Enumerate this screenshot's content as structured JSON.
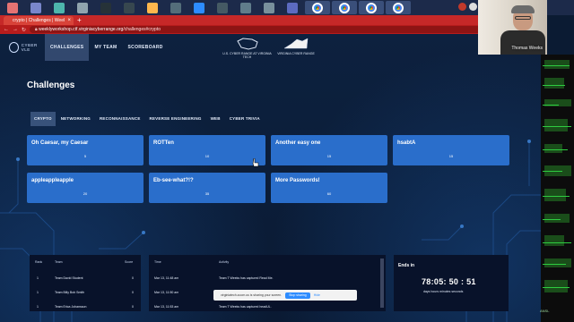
{
  "browser": {
    "tab_title": "crypto | Challenges | Weel",
    "tab_close": "×",
    "new_tab": "+",
    "url_host": "weeklyworkshop.ctf.virginiacyberrange.org",
    "url_path": "/challenges#crypto",
    "window_controls": [
      "–",
      "□",
      "×"
    ]
  },
  "site": {
    "nav": {
      "logo_text": "CYBER VLE",
      "items": [
        {
          "label": "CHALLENGES",
          "active": true
        },
        {
          "label": "MY TEAM",
          "active": false
        },
        {
          "label": "SCOREBOARD",
          "active": false
        }
      ],
      "sponsor_left": "U.S. CYBER RANGE AT VIRGINIA TECH",
      "sponsor_right": "VIRGINIA CYBER RANGE"
    },
    "title": "Challenges",
    "categories": [
      {
        "label": "CRYPTO",
        "active": true
      },
      {
        "label": "NETWORKING",
        "active": false
      },
      {
        "label": "RECONNAISSANCE",
        "active": false
      },
      {
        "label": "REVERSE ENGINEERING",
        "active": false
      },
      {
        "label": "WEB",
        "active": false
      },
      {
        "label": "CYBER TRIVIA",
        "active": false
      }
    ],
    "challenges": [
      {
        "name": "Oh Caesar, my Caesar",
        "points": "5"
      },
      {
        "name": "ROTTen",
        "points": "10"
      },
      {
        "name": "Another easy one",
        "points": "15"
      },
      {
        "name": "hsabtA",
        "points": "15"
      },
      {
        "name": "appleappleapple",
        "points": "20"
      },
      {
        "name": "Eb-see-what?!?",
        "points": "35"
      },
      {
        "name": "More Passwords!",
        "points": "60"
      }
    ],
    "scoreboard": {
      "headers": [
        "Rank",
        "Team",
        "Score"
      ],
      "rows": [
        {
          "rank": "1",
          "team": "Team David Student",
          "score": "0"
        },
        {
          "rank": "1",
          "team": "Team Billy Bob Smith",
          "score": "0"
        },
        {
          "rank": "1",
          "team": "Team Erica Johansson",
          "score": "0"
        }
      ]
    },
    "activity": {
      "headers": [
        "Time",
        "Activity"
      ],
      "rows": [
        {
          "time": "Mar 13, 11:48 am",
          "activity": "Team T Weeks has captured Read Me."
        },
        {
          "time": "Mar 13, 11:50 am",
          "activity": "Team T Weeks has captured roberts.txt."
        },
        {
          "time": "Mar 13, 11:53 am",
          "activity": "Team T Weeks has captured headUL."
        }
      ]
    },
    "countdown": {
      "heading": "Ends in",
      "value": "78:05: 50 : 51",
      "units": "days   hours   minutes   seconds"
    }
  },
  "zoom": {
    "share_text": "virginiatech.zoom.us is sharing your screen.",
    "stop_label": "Stop sharing",
    "hide_label": "Hide"
  },
  "webcam": {
    "name": "Thomas Weeks"
  },
  "monitor": {
    "label": "ANSL"
  },
  "colors": {
    "card": "#2a6ecb",
    "browser_red": "#c62828",
    "page_bg": "#0b1b33",
    "zoom_blue": "#2d8cff"
  }
}
